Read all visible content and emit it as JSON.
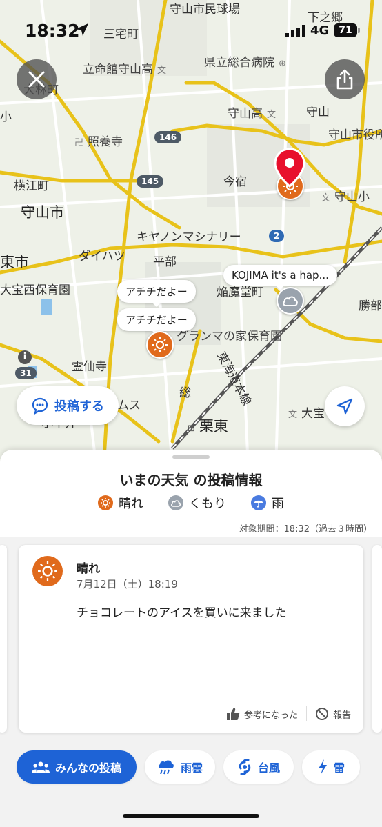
{
  "status_bar": {
    "time": "18:32",
    "network": "4G",
    "battery": "71"
  },
  "map": {
    "labels": {
      "shimonogo": "下之郷",
      "moriyama_stadium": "守山市民球場",
      "sanyakemachi": "三宅町",
      "ritsumeikan_high": "立命館守山高",
      "kenritsu_hospital": "県立総合病院",
      "obayashi": "大林町",
      "moriyama_high": "守山高",
      "moriyama": "守山",
      "moriyama_city_hall": "守山市役所",
      "shoyoji": "照養寺",
      "yokoe": "横江町",
      "imajuku": "今宿",
      "moriyama_elem": "守山小",
      "moriyama_city": "守山市",
      "canon": "キヤノンマシナリー",
      "daihatsu": "ダイハツ",
      "east_city": "東市",
      "ohoya_nursery": "大宝西保育園",
      "enmado": "焔魔堂町",
      "katsube": "勝部",
      "grandma_nursery": "グランマの家保育園",
      "reisenji": "霊仙寺",
      "tokaido_line": "東海道本線",
      "mutsumusu": "ムス",
      "koharu": "小平井",
      "sou": "総",
      "ritto": "栗東",
      "daiho": "大宝",
      "kosei": "小",
      "hirai_road": "平部"
    },
    "routes": {
      "r146": "146",
      "r145": "145",
      "r2": "2",
      "r31": "31"
    },
    "bubbles": {
      "kojima": "KOJIMA it's a hap...",
      "achichi_1": "アチチだよー",
      "achichi_2": "アチチだよー"
    },
    "post_button_label": "投稿する"
  },
  "sheet": {
    "title": "いまの天気 の投稿情報",
    "legend": [
      {
        "label": "晴れ",
        "icon": "sun-icon",
        "color": "#e06a1c"
      },
      {
        "label": "くもり",
        "icon": "cloud-icon",
        "color": "#9aa3ad"
      },
      {
        "label": "雨",
        "icon": "umbrella-icon",
        "color": "#4a7be0"
      }
    ],
    "period": "対象期間：18:32（過去３時間）",
    "card": {
      "weather": "晴れ",
      "date": "7月12日（土）18:19",
      "text": "チョコレートのアイスを買いに来ました",
      "helpful_label": "参考になった",
      "report_label": "報告"
    }
  },
  "bottom_tabs": [
    {
      "label": "みんなの投稿",
      "icon": "people-icon",
      "active": true
    },
    {
      "label": "雨雲",
      "icon": "rain-cloud-icon",
      "active": false
    },
    {
      "label": "台風",
      "icon": "typhoon-icon",
      "active": false
    },
    {
      "label": "雷",
      "icon": "lightning-icon",
      "active": false
    }
  ],
  "colors": {
    "accent": "#1e63d6",
    "sun": "#e06a1c",
    "road": "#e8c21a",
    "pin": "#e8102c"
  }
}
